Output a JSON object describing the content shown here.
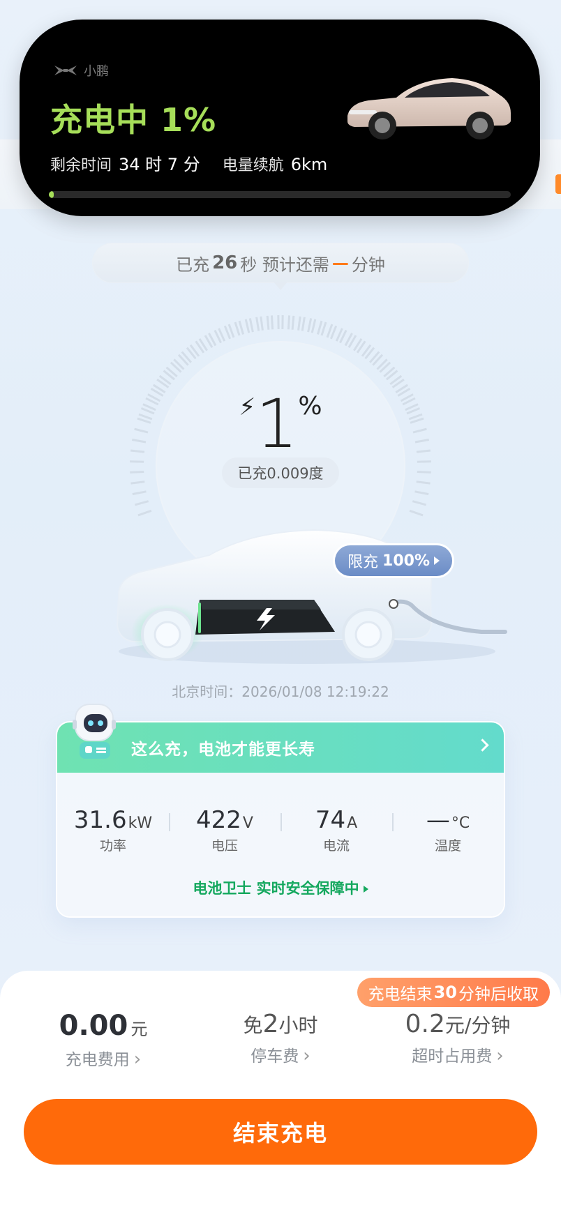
{
  "live_activity": {
    "brand": "小鹏",
    "status": "充电中 1%",
    "remaining_label": "剩余时间",
    "remaining_value": "34 时 7 分",
    "range_label": "电量续航",
    "range_value": "6km",
    "progress_percent": 1
  },
  "charge_time": {
    "prefix": "已充",
    "seconds": "26",
    "mid": "秒 预计还需",
    "dash": "—",
    "suffix": "分钟"
  },
  "gauge": {
    "percent": "1",
    "unit": "%",
    "energy_text": "已充0.009度"
  },
  "limit": {
    "prefix": "限充",
    "value": "100%"
  },
  "beijing_time": "北京时间：2026/01/08 12:19:22",
  "tip_card": {
    "title": "这么充，电池才能更长寿",
    "metrics": [
      {
        "value": "31.6",
        "unit": "kW",
        "label": "功率"
      },
      {
        "value": "422",
        "unit": "V",
        "label": "电压"
      },
      {
        "value": "74",
        "unit": "A",
        "label": "电流"
      },
      {
        "value": "—",
        "unit": "°C",
        "label": "温度"
      }
    ],
    "guard_text": "电池卫士 实时安全保障中"
  },
  "bottom": {
    "notice_pre": "充电结束",
    "notice_num": "30",
    "notice_post": "分钟后收取",
    "fees": [
      {
        "value": "0.00",
        "unit": "元",
        "label": "充电费用"
      },
      {
        "pre": "免",
        "value": "2",
        "post": "小时",
        "label": "停车费"
      },
      {
        "value": "0.2",
        "unit": "元/分钟",
        "label": "超时占用费"
      }
    ],
    "end_button": "结束充电"
  },
  "colors": {
    "accent_green": "#a6de59",
    "brand_orange": "#ff6a0a",
    "guard_green": "#14a85e"
  }
}
